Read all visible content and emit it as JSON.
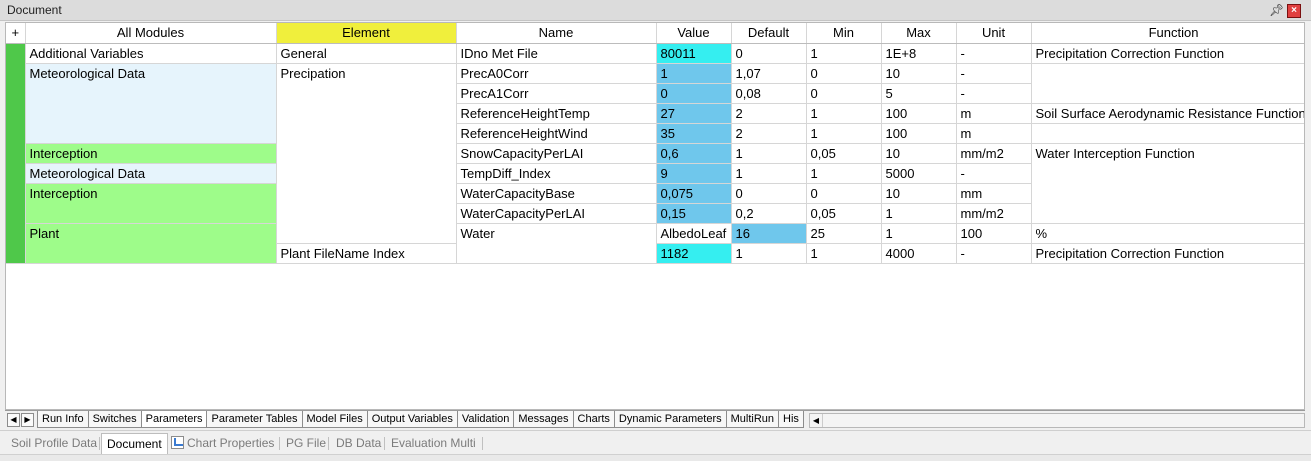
{
  "window": {
    "title": "Document",
    "pin_icon": "pin-icon",
    "close_icon": "close-icon"
  },
  "table": {
    "add_symbol": "+",
    "headers": {
      "modules": "All Modules",
      "element": "Element",
      "name": "Name",
      "value": "Value",
      "default": "Default",
      "min": "Min",
      "max": "Max",
      "unit": "Unit",
      "function": "Function"
    },
    "rows": [
      {
        "module": "Additional Variables",
        "element": "General",
        "name": "IDno Met File",
        "value": "80011",
        "default": "0",
        "min": "1",
        "max": "1E+8",
        "unit": "-",
        "function": "Precipitation Correction Function"
      },
      {
        "module": "Meteorological Data",
        "element": "Precipation",
        "name": "PrecA0Corr",
        "value": "1",
        "default": "1,07",
        "min": "0",
        "max": "10",
        "unit": "-",
        "function": ""
      },
      {
        "module": "",
        "element": "",
        "name": "PrecA1Corr",
        "value": "0",
        "default": "0,08",
        "min": "0",
        "max": "5",
        "unit": "-",
        "function": ""
      },
      {
        "module": "",
        "element": "",
        "name": "ReferenceHeightTemp",
        "value": "27",
        "default": "2",
        "min": "1",
        "max": "100",
        "unit": "m",
        "function": "Soil Surface Aerodynamic Resistance Function"
      },
      {
        "module": "",
        "element": "",
        "name": "ReferenceHeightWind",
        "value": "35",
        "default": "2",
        "min": "1",
        "max": "100",
        "unit": "m",
        "function": ""
      },
      {
        "module": "Interception",
        "element": "",
        "name": "SnowCapacityPerLAI",
        "value": "0,6",
        "default": "1",
        "min": "0,05",
        "max": "10",
        "unit": "mm/m2",
        "function": "Water Interception Function"
      },
      {
        "module": "Meteorological Data",
        "element": "",
        "name": "TempDiff_Index",
        "value": "9",
        "default": "1",
        "min": "1",
        "max": "5000",
        "unit": "-",
        "function": ""
      },
      {
        "module": "Interception",
        "element": "",
        "name": "WaterCapacityBase",
        "value": "0,075",
        "default": "0",
        "min": "0",
        "max": "10",
        "unit": "mm",
        "function": ""
      },
      {
        "module": "",
        "element": "",
        "name": "WaterCapacityPerLAI",
        "value": "0,15",
        "default": "0,2",
        "min": "0,05",
        "max": "1",
        "unit": "mm/m2",
        "function": ""
      },
      {
        "module": "Plant",
        "element": "Water",
        "name": "AlbedoLeaf",
        "value": "16",
        "default": "25",
        "min": "1",
        "max": "100",
        "unit": "%",
        "function": ""
      },
      {
        "module": "",
        "element": "",
        "name": "Plant FileName Index",
        "value": "1182",
        "default": "1",
        "min": "1",
        "max": "4000",
        "unit": "-",
        "function": "Precipitation Correction Function"
      }
    ]
  },
  "sheet_tabs": {
    "first_icon": "first-sheet-icon",
    "next_icon": "next-sheet-icon",
    "items": [
      "Run Info",
      "Switches",
      "Parameters",
      "Parameter Tables",
      "Model Files",
      "Output Variables",
      "Validation",
      "Messages",
      "Charts",
      "Dynamic Parameters",
      "MultiRun",
      "His"
    ],
    "active": "Parameters",
    "scroll_left_icon": "scroll-left-icon"
  },
  "doc_tabs": {
    "items": [
      "Soil Profile Data",
      "Document",
      "Chart Properties",
      "PG File",
      "DB Data",
      "Evaluation Multi"
    ],
    "active": "Document",
    "chart_icon": "chart-properties-icon"
  },
  "colors": {
    "element_header": "#f0ef3c",
    "module_green": "#9efc8a",
    "module_blue": "#e6f4fc",
    "value_blue": "#6fc7ec",
    "value_cyan": "#35eef0",
    "row_bar": "#4fc84a"
  }
}
